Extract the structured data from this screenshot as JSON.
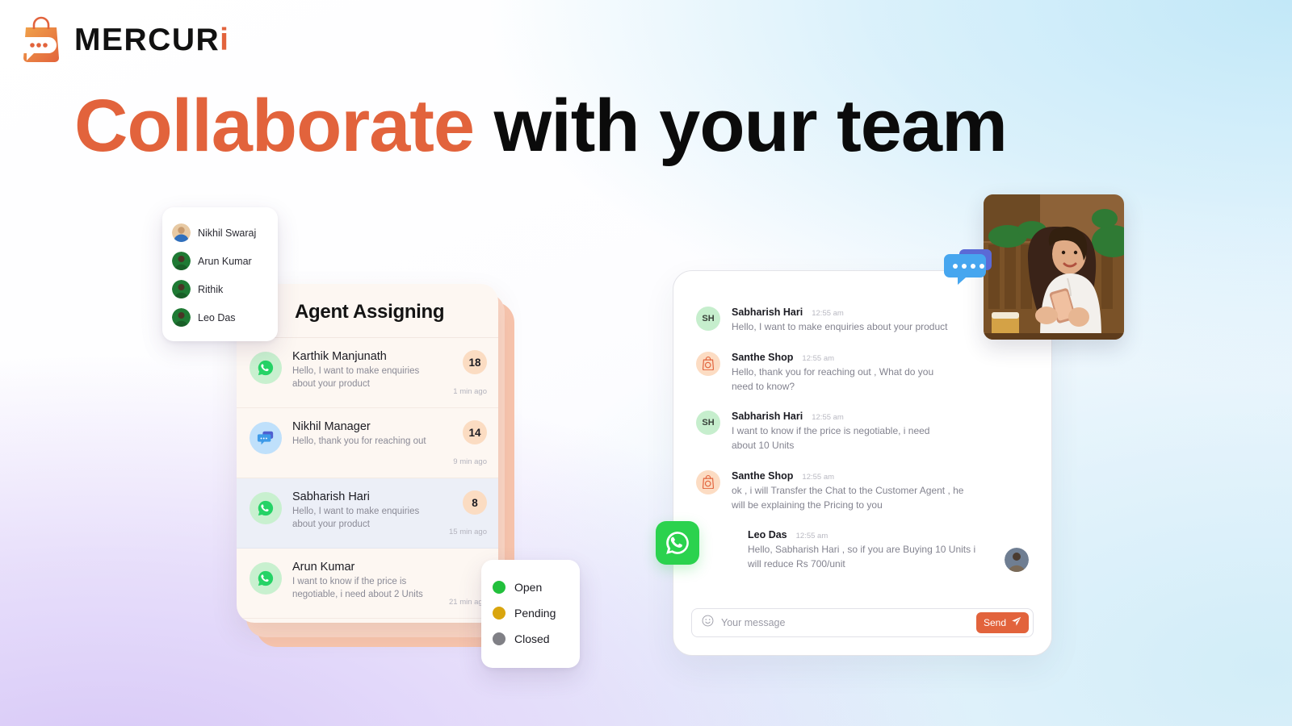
{
  "brand": {
    "name": "MERCUR",
    "name_accent": "i",
    "logo_icon": "shopping-bag-chat-logo",
    "accent_color": "#e2633c"
  },
  "headline": {
    "part_orange": "Collaborate",
    "part_black": "with your team"
  },
  "agents_dropdown": {
    "items": [
      {
        "name": "Nikhil Swaraj",
        "avatar": "avatar-photo-nikhil"
      },
      {
        "name": "Arun Kumar",
        "avatar": "avatar-photo-arun"
      },
      {
        "name": "Rithik",
        "avatar": "avatar-photo-rithik"
      },
      {
        "name": "Leo Das",
        "avatar": "avatar-photo-leo"
      }
    ]
  },
  "agent_assigning": {
    "title": "Agent Assigning",
    "chats": [
      {
        "name": "Karthik Manjunath",
        "message": "Hello, I want to make enquiries about your product",
        "badge": "18",
        "time": "1 min ago",
        "channel_icon": "whatsapp-icon",
        "active": false
      },
      {
        "name": "Nikhil Manager",
        "message": "Hello, thank you for reaching out",
        "badge": "14",
        "time": "9 min ago",
        "channel_icon": "chat-bubble-icon",
        "active": false
      },
      {
        "name": "Sabharish Hari",
        "message": "Hello, I want to make enquiries about your product",
        "badge": "8",
        "time": "15 min ago",
        "channel_icon": "whatsapp-icon",
        "active": true
      },
      {
        "name": "Arun Kumar",
        "message": "I want to know if the price is negotiable, i need about 2 Units",
        "badge": "",
        "time": "21 min ago",
        "channel_icon": "whatsapp-icon",
        "active": false
      }
    ]
  },
  "status_legend": {
    "items": [
      {
        "label": "Open",
        "color": "#22c03c"
      },
      {
        "label": "Pending",
        "color": "#d9a50e"
      },
      {
        "label": "Closed",
        "color": "#808086"
      }
    ]
  },
  "conversation": {
    "messages": [
      {
        "sender": "Sabharish Hari",
        "time": "12:55 am",
        "text": "Hello, I want to make enquiries about your product",
        "avatar_initials": "SH",
        "avatar_kind": "initials",
        "direction": "in"
      },
      {
        "sender": "Santhe Shop",
        "time": "12:55 am",
        "text": "Hello, thank you for reaching out , What do you need to know?",
        "avatar_initials": "",
        "avatar_kind": "shop-logo-icon",
        "direction": "in"
      },
      {
        "sender": "Sabharish Hari",
        "time": "12:55 am",
        "text": "I want to know if the price is negotiable, i need about 10 Units",
        "avatar_initials": "SH",
        "avatar_kind": "initials",
        "direction": "in"
      },
      {
        "sender": "Santhe Shop",
        "time": "12:55 am",
        "text": "ok , i will Transfer the Chat to the Customer Agent , he will be explaining the Pricing to you",
        "avatar_initials": "",
        "avatar_kind": "shop-logo-icon",
        "direction": "in"
      },
      {
        "sender": "Leo Das",
        "time": "12:55 am",
        "text": "Hello, Sabharish Hari , so if you are Buying 10 Units i will reduce Rs 700/unit",
        "avatar_initials": "",
        "avatar_kind": "photo",
        "direction": "out"
      }
    ],
    "composer": {
      "placeholder": "Your message",
      "emoji_icon": "smiley-icon",
      "send_label": "Send",
      "send_icon": "paper-plane-icon",
      "send_color": "#e2633c"
    }
  },
  "decorations": {
    "whatsapp_badge": "whatsapp-icon",
    "chat_bubbles": "double-chat-bubble-icon",
    "photo": "woman-with-phone-photo"
  }
}
